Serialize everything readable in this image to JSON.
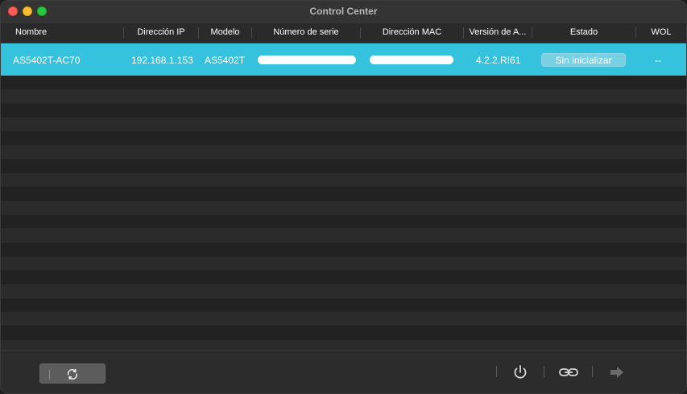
{
  "window": {
    "title": "Control Center"
  },
  "table": {
    "columns": [
      {
        "key": "name",
        "label": "Nombre"
      },
      {
        "key": "ip",
        "label": "Dirección IP"
      },
      {
        "key": "model",
        "label": "Modelo"
      },
      {
        "key": "serial",
        "label": "Número de serie"
      },
      {
        "key": "mac",
        "label": "Dirección MAC"
      },
      {
        "key": "version",
        "label": "Versión de A..."
      },
      {
        "key": "status",
        "label": "Estado"
      },
      {
        "key": "wol",
        "label": "WOL"
      }
    ],
    "rows": [
      {
        "name": "AS5402T-AC70",
        "ip": "192.168.1.153",
        "model": "AS5402T",
        "serial": "",
        "mac": "",
        "version": "4.2.2.RI61",
        "status": "Sin inicializar",
        "wol": "--",
        "selected": true
      }
    ]
  },
  "footer": {
    "refresh_icon": "refresh-icon",
    "power_icon": "power-icon",
    "link_icon": "link-icon",
    "arrow_icon": "arrow-right-icon"
  },
  "colors": {
    "selection": "#35c2dd",
    "status_button": "#7ad0e3",
    "window_bg": "#262626"
  }
}
